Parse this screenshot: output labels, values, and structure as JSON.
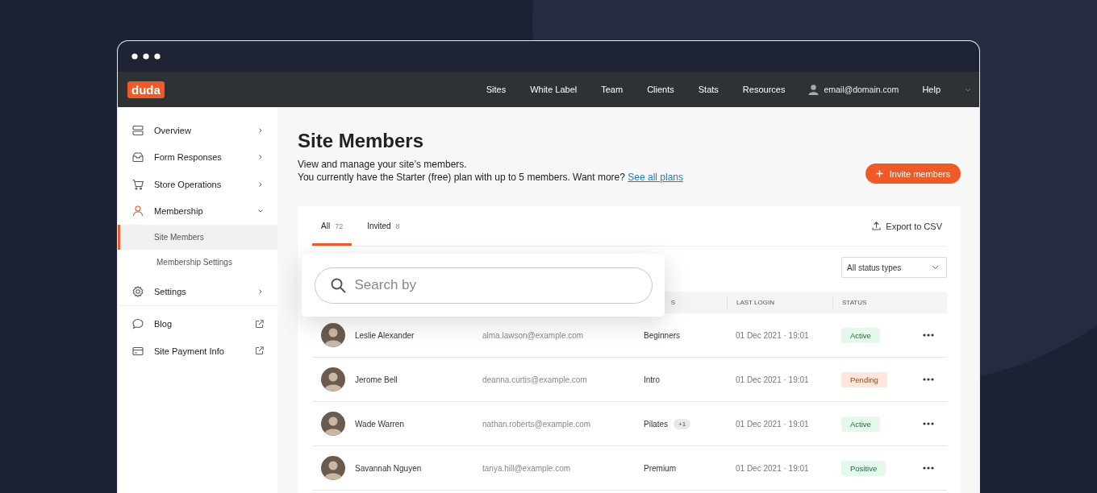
{
  "topnav": {
    "logo": "duda",
    "items": [
      "Sites",
      "White Label",
      "Team",
      "Clients",
      "Stats",
      "Resources"
    ],
    "account": "email@domain.com",
    "help": "Help"
  },
  "sidebar": {
    "items": [
      {
        "label": "Overview",
        "kind": "section",
        "expanded": false
      },
      {
        "label": "Form Responses",
        "kind": "section",
        "expanded": false
      },
      {
        "label": "Store Operations",
        "kind": "section",
        "expanded": false
      },
      {
        "label": "Membership",
        "kind": "section",
        "expanded": true
      },
      {
        "label": "Site Members",
        "kind": "sub",
        "selected": true
      },
      {
        "label": "Membership Settings",
        "kind": "sub",
        "selected": false
      },
      {
        "label": "Settings",
        "kind": "section",
        "expanded": false
      }
    ],
    "links": [
      "Blog",
      "Site Payment Info"
    ]
  },
  "page": {
    "title": "Site Members",
    "description": "View and manage your site’s members.",
    "plan_note": "You currently have the Starter (free) plan with up to 5 members. Want more?",
    "plan_link": "See all plans",
    "invite_button": "Invite members"
  },
  "tabs": [
    {
      "label": "All",
      "count": "72",
      "selected": true
    },
    {
      "label": "Invited",
      "count": "8",
      "selected": false
    }
  ],
  "export_button": "Export to CSV",
  "search": {
    "placeholder": "Search by"
  },
  "status_filter": "All status types",
  "table": {
    "columns": [
      "S",
      "LAST LOGIN",
      "STATUS"
    ],
    "rows": [
      {
        "name": "Leslie Alexander",
        "email": "alma.lawson@example.com",
        "group": "Beginners",
        "last_login": "01 Dec 2021 · 19:01",
        "status": "Active",
        "kind": "active"
      },
      {
        "name": "Jerome Bell",
        "email": "deanna.curtis@example.com",
        "group": "Intro",
        "last_login": "01 Dec 2021 · 19:01",
        "status": "Pending",
        "kind": "pending"
      },
      {
        "name": "Wade Warren",
        "email": "nathan.roberts@example.com",
        "group": "Pilates",
        "extra": "+1",
        "last_login": "01 Dec 2021 · 19:01",
        "status": "Active",
        "kind": "active"
      },
      {
        "name": "Savannah Nguyen",
        "email": "tanya.hill@example.com",
        "group": "Premium",
        "last_login": "01 Dec 2021 · 19:01",
        "status": "Positive",
        "kind": "active"
      }
    ]
  }
}
